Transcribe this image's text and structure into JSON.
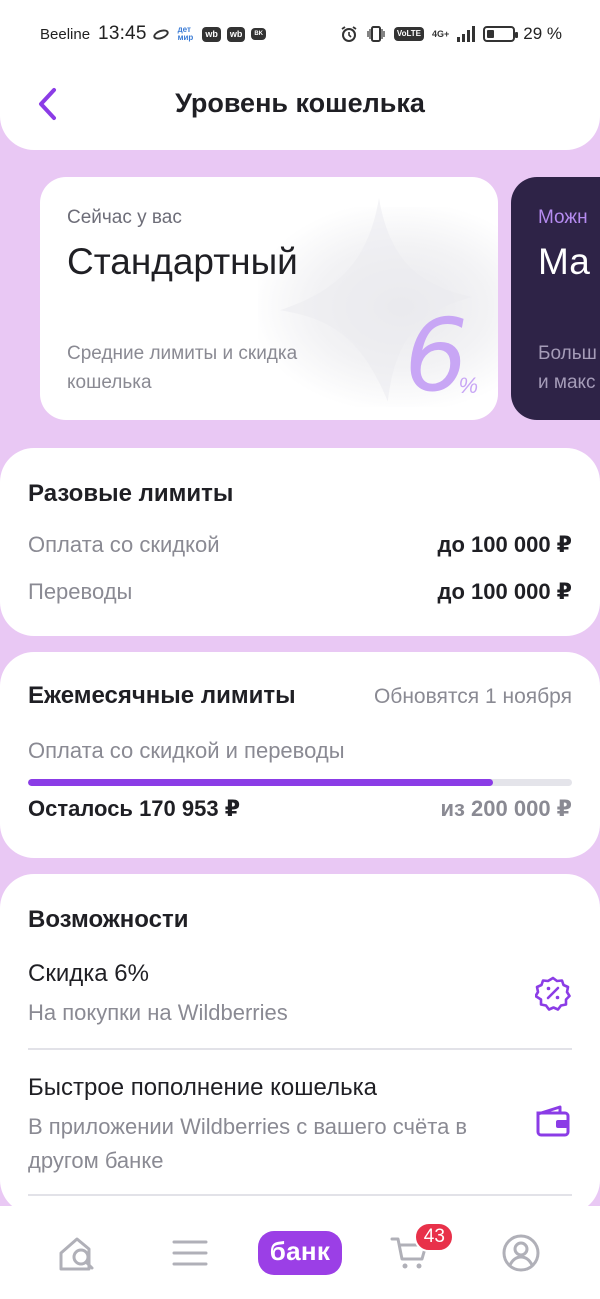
{
  "status_bar": {
    "carrier": "Beeline",
    "time": "13:45",
    "icons": [
      "ring-icon",
      "detmir-icon",
      "wb-icon",
      "wb-icon",
      "burger-king-icon"
    ],
    "right_icons": [
      "alarm-icon",
      "vibrate-icon",
      "volte-icon",
      "signal-icon"
    ],
    "volte": "VoLTE",
    "network": "4G+",
    "battery_percent": "29 %",
    "battery_level": 0.29
  },
  "header": {
    "title": "Уровень кошелька",
    "back_icon": "chevron-left-icon"
  },
  "colors": {
    "accent": "#9b3fe6",
    "background": "#e9c8f4",
    "percent": "#c8a6f5",
    "next_card": "#2e2347",
    "badge": "#e8314a"
  },
  "current_level": {
    "kicker": "Сейчас у вас",
    "name": "Стандартный",
    "description": "Средние лимиты и скидка кошелька",
    "discount": "6",
    "discount_unit": "%"
  },
  "next_level": {
    "kicker": "Можн",
    "name": "Ма",
    "description_line1": "Больш",
    "description_line2": "и макс"
  },
  "one_time_limits": {
    "title": "Разовые лимиты",
    "rows": [
      {
        "label": "Оплата со скидкой",
        "value": "до 100 000 ₽"
      },
      {
        "label": "Переводы",
        "value": "до 100 000 ₽"
      }
    ]
  },
  "monthly_limits": {
    "title": "Ежемесячные лимиты",
    "note": "Обновятся 1 ноября",
    "subtitle": "Оплата со скидкой и переводы",
    "progress": 0.855,
    "remaining": "Осталось 170 953 ₽",
    "total": "из 200 000 ₽"
  },
  "features": {
    "title": "Возможности",
    "items": [
      {
        "title": "Скидка 6%",
        "subtitle": "На покупки на Wildberries",
        "icon": "discount-badge-icon"
      },
      {
        "title": "Быстрое пополнение кошелька",
        "subtitle": "В приложении Wildberries с вашего счёта в другом банке",
        "icon": "wallet-icon"
      }
    ]
  },
  "bottom_nav": {
    "home_icon": "home-search-icon",
    "menu_icon": "menu-icon",
    "bank_label": "банк",
    "cart_icon": "cart-icon",
    "cart_count": "43",
    "profile_icon": "profile-icon"
  }
}
